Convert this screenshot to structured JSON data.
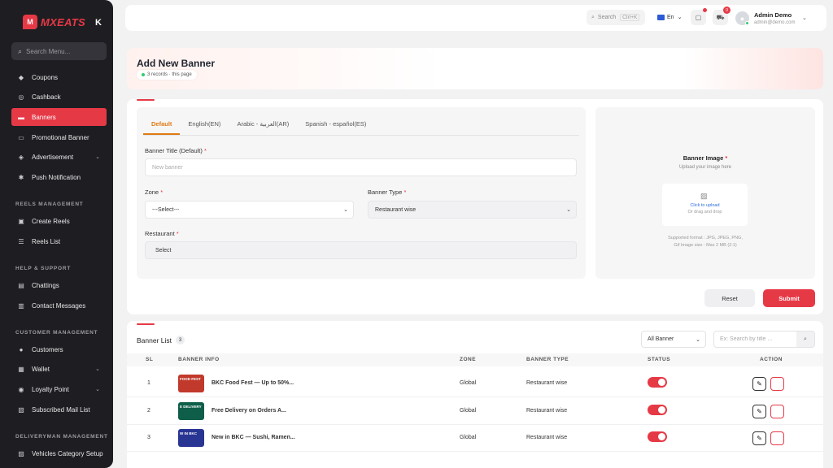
{
  "brand": {
    "name": "MXEATS",
    "logo_letter": "M",
    "collapse_glyph": "K"
  },
  "sidebar": {
    "search_placeholder": "Search Menu...",
    "items": [
      {
        "label": "Coupons",
        "icon": "tag-icon",
        "glyph": "◆"
      },
      {
        "label": "Cashback",
        "icon": "cashback-icon",
        "glyph": "◎"
      },
      {
        "label": "Banners",
        "icon": "banner-icon",
        "glyph": "▬",
        "active": true
      },
      {
        "label": "Promotional Banner",
        "icon": "promo-banner-icon",
        "glyph": "▭"
      },
      {
        "label": "Advertisement",
        "icon": "megaphone-icon",
        "glyph": "◈"
      },
      {
        "label": "Push Notification",
        "icon": "bell-icon",
        "glyph": "✱"
      },
      {
        "label": "Create Reels",
        "icon": "video-icon",
        "glyph": "▣"
      },
      {
        "label": "Reels List",
        "icon": "list-icon",
        "glyph": "☰"
      },
      {
        "label": "Chattings",
        "icon": "chat-icon",
        "glyph": "▤"
      },
      {
        "label": "Contact Messages",
        "icon": "message-icon",
        "glyph": "▥"
      },
      {
        "label": "Customers",
        "icon": "user-icon",
        "glyph": "●"
      },
      {
        "label": "Wallet",
        "icon": "wallet-icon",
        "glyph": "▦"
      },
      {
        "label": "Loyalty Point",
        "icon": "loyalty-icon",
        "glyph": "◉"
      },
      {
        "label": "Subscribed Mail List",
        "icon": "mail-icon",
        "glyph": "▧"
      },
      {
        "label": "Vehicles Category Setup",
        "icon": "vehicle-icon",
        "glyph": "▨"
      }
    ],
    "sections": {
      "reels": "REELS MANAGEMENT",
      "help": "HELP & SUPPORT",
      "customer": "CUSTOMER MANAGEMENT",
      "deliveryman": "DELIVERYMAN MANAGEMENT"
    }
  },
  "topbar": {
    "search_label": "Search",
    "search_shortcut": "Ctrl+K",
    "language": "En",
    "cart_count": "0",
    "admin_name": "Admin Demo",
    "admin_email": "admin@demo.com"
  },
  "header": {
    "title": "Add New Banner",
    "records": "3 records · this page"
  },
  "form": {
    "tabs": [
      "Default",
      "English(EN)",
      "Arabic - العربية(AR)",
      "Spanish - español(ES)"
    ],
    "title_label": "Banner Title (Default)",
    "title_placeholder": "New banner",
    "zone_label": "Zone",
    "zone_value": "---Select---",
    "type_label": "Banner Type",
    "type_value": "Restaurant wise",
    "restaurant_label": "Restaurant",
    "restaurant_value": "Select",
    "required_mark": "*"
  },
  "image_panel": {
    "title": "Banner Image",
    "subtitle": "Upload your image here",
    "click_text": "Click to upload",
    "drag_text": "Or drag and drop",
    "formats": "Supported format : JPG, JPEG, PNG,",
    "size": "Gif Image size : Max 2 MB (2:1)"
  },
  "buttons": {
    "reset": "Reset",
    "submit": "Submit"
  },
  "list": {
    "title": "Banner List",
    "count": "3",
    "filter_value": "All Banner",
    "search_placeholder": "Ex: Search by title ...",
    "columns": [
      "SL",
      "BANNER INFO",
      "ZONE",
      "BANNER TYPE",
      "STATUS",
      "ACTION"
    ],
    "rows": [
      {
        "sl": "1",
        "title": "BKC Food Fest — Up to 50%...",
        "zone": "Global",
        "type": "Restaurant wise",
        "thumb_text": "FOOD FEST",
        "thumb_color": "#c0392b"
      },
      {
        "sl": "2",
        "title": "Free Delivery on Orders A...",
        "zone": "Global",
        "type": "Restaurant wise",
        "thumb_text": "E DELIVERY",
        "thumb_color": "#0f5e4a"
      },
      {
        "sl": "3",
        "title": "New in BKC — Sushi, Ramen...",
        "zone": "Global",
        "type": "Restaurant wise",
        "thumb_text": "W IN BKC",
        "thumb_color": "#283593"
      }
    ]
  },
  "colors": {
    "accent": "#e63946",
    "tab_active": "#e07a12",
    "sidebar_bg": "#1e1e22"
  }
}
